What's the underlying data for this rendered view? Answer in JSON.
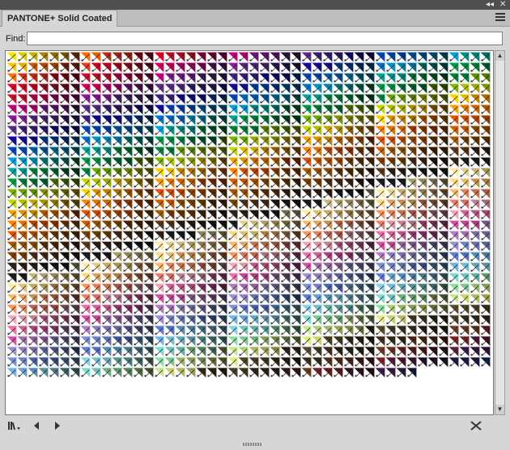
{
  "window": {
    "controls": {
      "collapse": "◂◂",
      "close": "✕"
    }
  },
  "panel": {
    "tab_title": "PANTONE+ Solid Coated",
    "menu_icon": "hamburger-menu-icon"
  },
  "find": {
    "label": "Find:",
    "value": "",
    "placeholder": ""
  },
  "swatch_grid": {
    "palette": [
      "#f7e600",
      "#ffc20e",
      "#ff6f00",
      "#e8381a",
      "#e20022",
      "#c8102e",
      "#d50057",
      "#c5007f",
      "#8a1a9b",
      "#5b2c86",
      "#3d1f7f",
      "#10069f",
      "#0047bb",
      "#0072ce",
      "#00a3e0",
      "#00a499",
      "#009b48",
      "#00843d",
      "#7ab800",
      "#c4d600",
      "#ffd100",
      "#f4a300",
      "#ff8200",
      "#e35205",
      "#d45d00",
      "#a65a00",
      "#7a3e00",
      "#5c3317",
      "#2f1e12",
      "#1a1a1a",
      "#fde9a0",
      "#fbd87f",
      "#fbb86b",
      "#f99360",
      "#ef7b6b",
      "#f4a6b8",
      "#ee6ca7",
      "#d94fa5",
      "#b47ac0",
      "#9b8fd3",
      "#7e8fd9",
      "#5e7ed6",
      "#6fb3e8",
      "#86d2ec",
      "#7edcd1",
      "#8ce0a0",
      "#c6e88a",
      "#e0ec7a",
      "#5a4a2a",
      "#4a3b22",
      "#3a2e1a",
      "#6b3a1e",
      "#7a2222",
      "#5a1a3a",
      "#3a1a4a",
      "#1a1a4a",
      "#0a2a5a",
      "#0a3a4a",
      "#0a4a3a",
      "#1a4a1a",
      "#3a4a0a",
      "#4a3a0a"
    ],
    "swatch_count": 1419,
    "columns": 46,
    "rows": 33,
    "swatch_icon": "spot-color-triangle-icon"
  },
  "footer": {
    "library_menu_icon": "swatch-library-menu-icon",
    "prev_icon": "previous-library-icon",
    "next_icon": "next-library-icon",
    "tools_icon": "swatch-tools-icon"
  }
}
